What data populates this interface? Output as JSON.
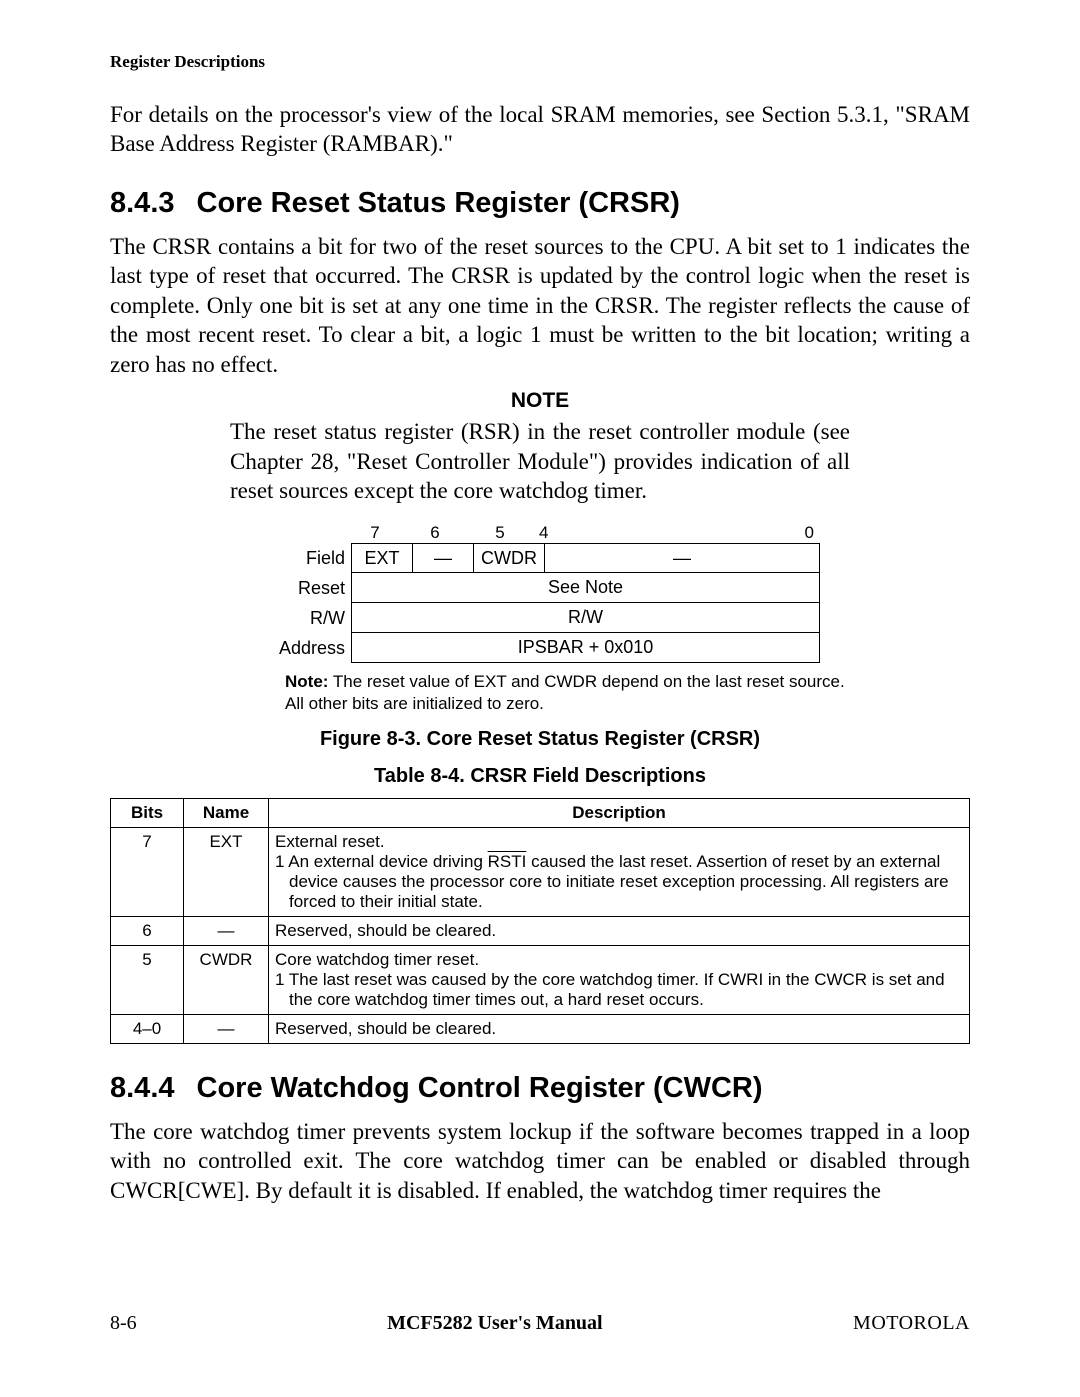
{
  "header": {
    "title": "Register Descriptions"
  },
  "intro": "For details on the processor's view of the local SRAM memories, see Section 5.3.1, \"SRAM Base Address Register (RAMBAR).\"",
  "sec843": {
    "num": "8.4.3",
    "title": "Core Reset Status Register (CRSR)",
    "para": "The CRSR contains a bit for two of the reset sources to the CPU. A bit set to 1 indicates the last type of reset that occurred. The CRSR is updated by the  control logic when the reset is complete. Only one bit is set at any one time in the CRSR. The register reflects the cause of the most recent reset. To clear a bit, a logic 1 must be written to the bit location; writing a zero has no effect."
  },
  "note": {
    "label": "NOTE",
    "text": "The reset status register (RSR) in the reset controller module (see Chapter 28, \"Reset Controller Module\") provides indication of all reset sources except the core watchdog timer."
  },
  "reg": {
    "bit_labels": [
      "7",
      "6",
      "5",
      "4",
      "0"
    ],
    "rows": {
      "field_label": "Field",
      "field_cells": [
        "EXT",
        "—",
        "CWDR",
        "—"
      ],
      "reset_label": "Reset",
      "reset_value": "See Note",
      "rw_label": "R/W",
      "rw_value": "R/W",
      "addr_label": "Address",
      "addr_value": "IPSBAR + 0x010"
    },
    "note_prefix": "Note:",
    "note_text": "The reset value of EXT and CWDR depend on the last reset source. All other bits are initialized to zero."
  },
  "fig_caption": "Figure 8-3.  Core Reset Status Register (CRSR)",
  "tbl_caption": "Table 8-4. CRSR Field Descriptions",
  "table": {
    "headers": [
      "Bits",
      "Name",
      "Description"
    ],
    "rows": [
      {
        "bits": "7",
        "name": "EXT",
        "desc_lead": "External reset.",
        "desc_item_pre": "1  An external device driving ",
        "desc_item_ov": "RSTI",
        "desc_item_post": " caused the last reset. Assertion of reset by an external device causes the processor core to initiate reset exception processing. All registers are forced to their initial state."
      },
      {
        "bits": "6",
        "name": "—",
        "desc_plain": "Reserved, should be cleared."
      },
      {
        "bits": "5",
        "name": "CWDR",
        "desc_lead": "Core watchdog timer reset.",
        "desc_item": "1  The last reset was caused by the core watchdog timer. If CWRI in the CWCR is set and the core watchdog timer times out, a hard reset occurs."
      },
      {
        "bits": "4–0",
        "name": "—",
        "desc_plain": "Reserved, should be cleared."
      }
    ]
  },
  "sec844": {
    "num": "8.4.4",
    "title": "Core Watchdog Control Register (CWCR)",
    "para": "The core watchdog timer prevents system lockup if the software becomes trapped in a loop with no controlled exit. The core watchdog timer can be enabled or disabled through CWCR[CWE]. By default it is disabled. If enabled, the watchdog timer requires the"
  },
  "footer": {
    "left": "8-6",
    "center": "MCF5282 User's Manual",
    "right": "MOTOROLA"
  }
}
